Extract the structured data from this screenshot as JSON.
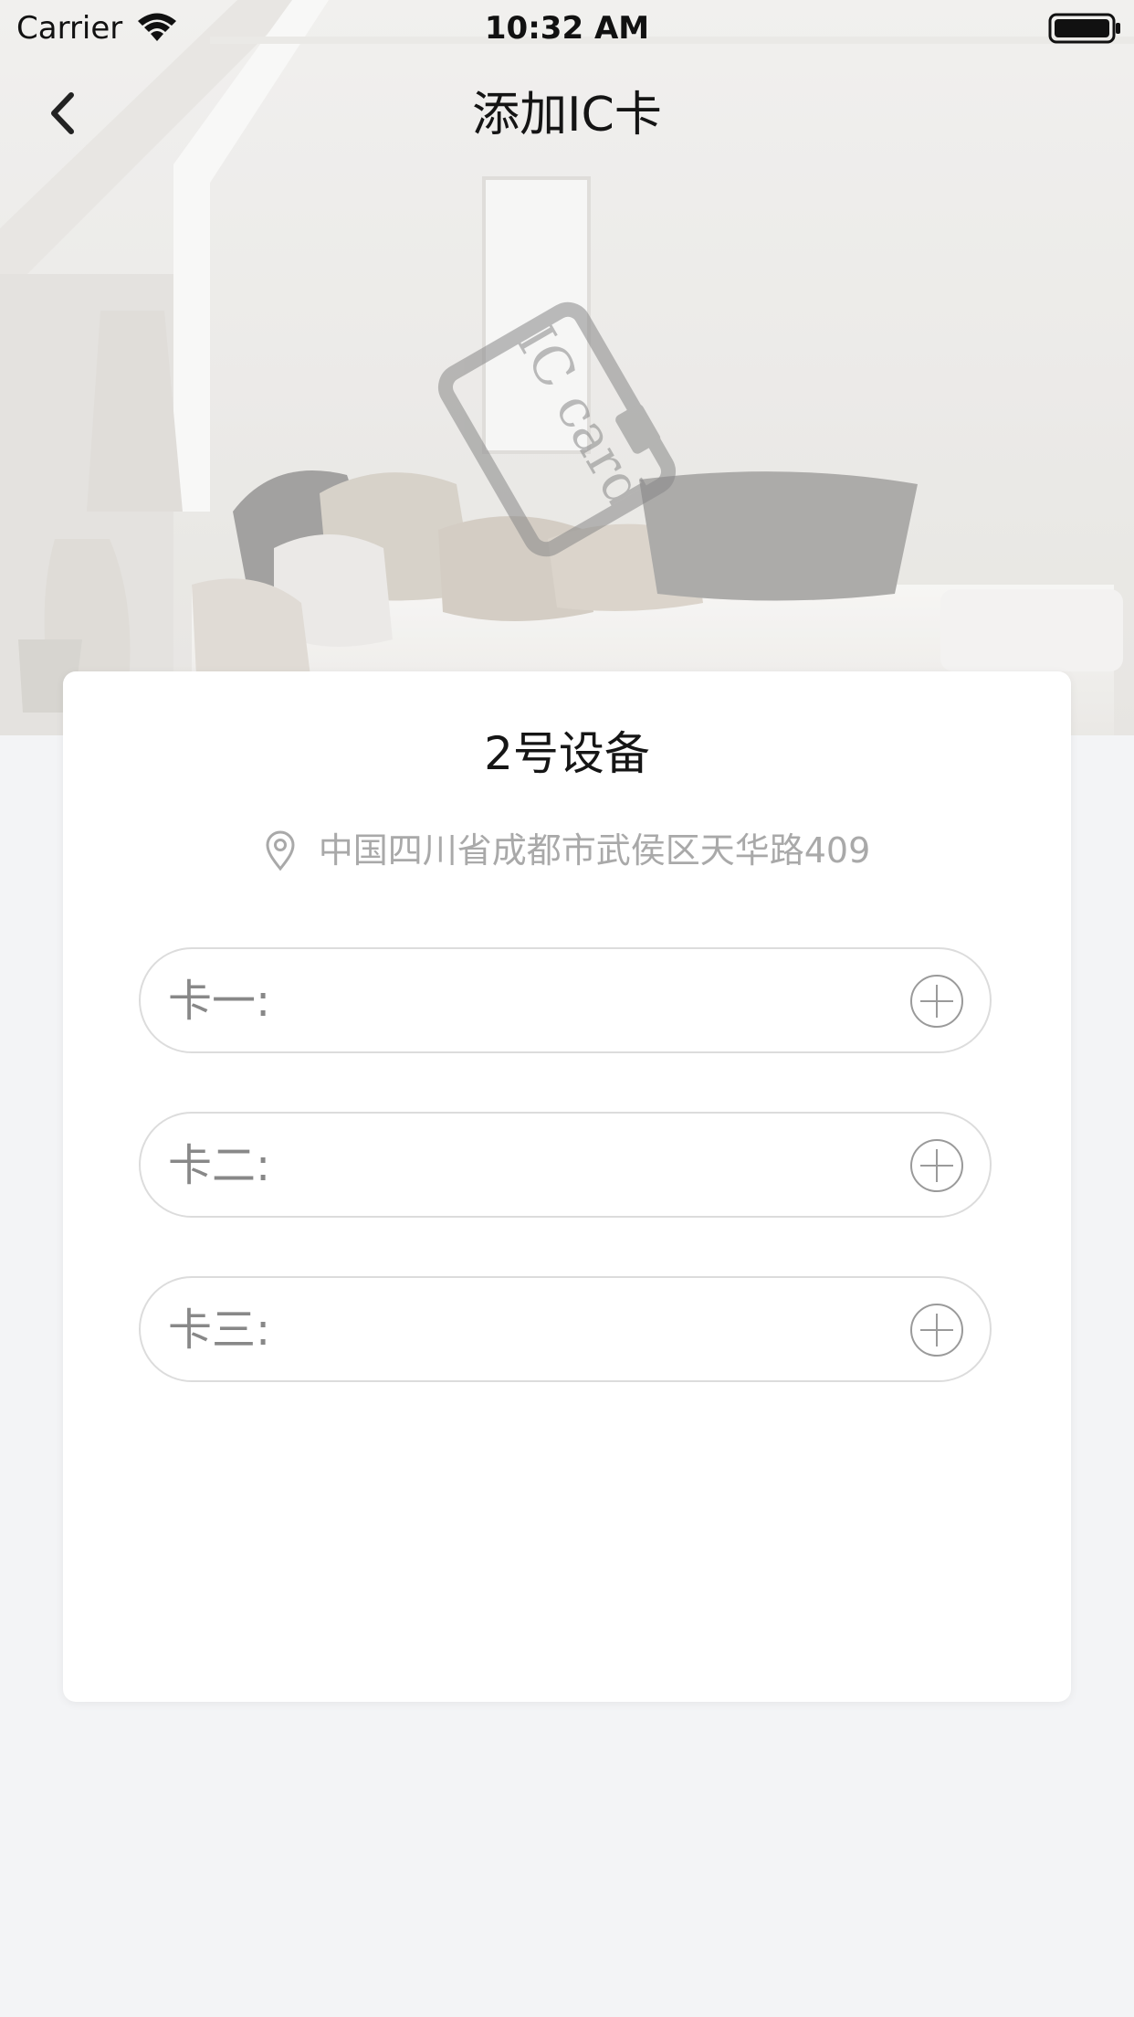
{
  "status_bar": {
    "carrier": "Carrier",
    "time": "10:32 AM"
  },
  "nav": {
    "title": "添加IC卡",
    "back_icon": "chevron-left-icon"
  },
  "hero": {
    "card_text": "IC card"
  },
  "device": {
    "name": "2号设备",
    "address": "中国四川省成都市武侯区天华路409",
    "address_icon": "location-pin-icon"
  },
  "cards": [
    {
      "label": "卡一:",
      "value": "",
      "add_icon": "plus-circle-icon"
    },
    {
      "label": "卡二:",
      "value": "",
      "add_icon": "plus-circle-icon"
    },
    {
      "label": "卡三:",
      "value": "",
      "add_icon": "plus-circle-icon"
    }
  ],
  "colors": {
    "page_background": "#f3f4f6",
    "card_background": "#ffffff",
    "field_border": "#dcdcdc",
    "muted_text": "#a9a9a9"
  }
}
